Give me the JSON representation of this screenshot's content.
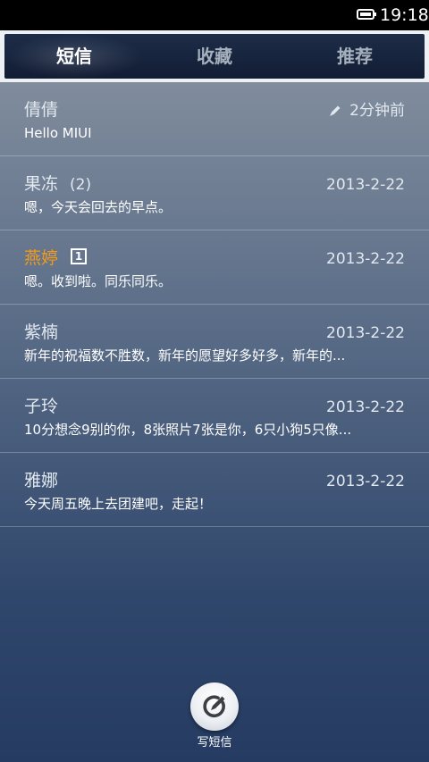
{
  "status_bar": {
    "time": "19:18",
    "battery_icon": "battery-full-icon"
  },
  "tabs": [
    {
      "label": "短信",
      "active": true
    },
    {
      "label": "收藏",
      "active": false
    },
    {
      "label": "推荐",
      "active": false
    }
  ],
  "messages": [
    {
      "name": "倩倩",
      "count": "",
      "badge": "",
      "time": "2分钟前",
      "draft": true,
      "preview": "Hello MIUI"
    },
    {
      "name": "果冻",
      "count": "(2)",
      "badge": "",
      "time": "2013-2-22",
      "draft": false,
      "preview": "嗯，今天会回去的早点。"
    },
    {
      "name": "燕婷",
      "count": "",
      "badge": "1",
      "time": "2013-2-22",
      "draft": false,
      "preview": "嗯。收到啦。同乐同乐。"
    },
    {
      "name": "紫楠",
      "count": "",
      "badge": "",
      "time": "2013-2-22",
      "draft": false,
      "preview": "新年的祝福数不胜数，新年的愿望好多好多，新年的..."
    },
    {
      "name": "子玲",
      "count": "",
      "badge": "",
      "time": "2013-2-22",
      "draft": false,
      "preview": "10分想念9别的你，8张照片7张是你，6只小狗5只像..."
    },
    {
      "name": "雅娜",
      "count": "",
      "badge": "",
      "time": "2013-2-22",
      "draft": false,
      "preview": "今天周五晚上去团建吧，走起！"
    }
  ],
  "compose": {
    "label": "写短信",
    "icon": "compose-icon"
  },
  "colors": {
    "unread_name": "#f39a1c",
    "tab_bar_bg": "#16223b",
    "active_tab_text": "#ffffff",
    "inactive_tab_text": "#a6b0bd"
  }
}
